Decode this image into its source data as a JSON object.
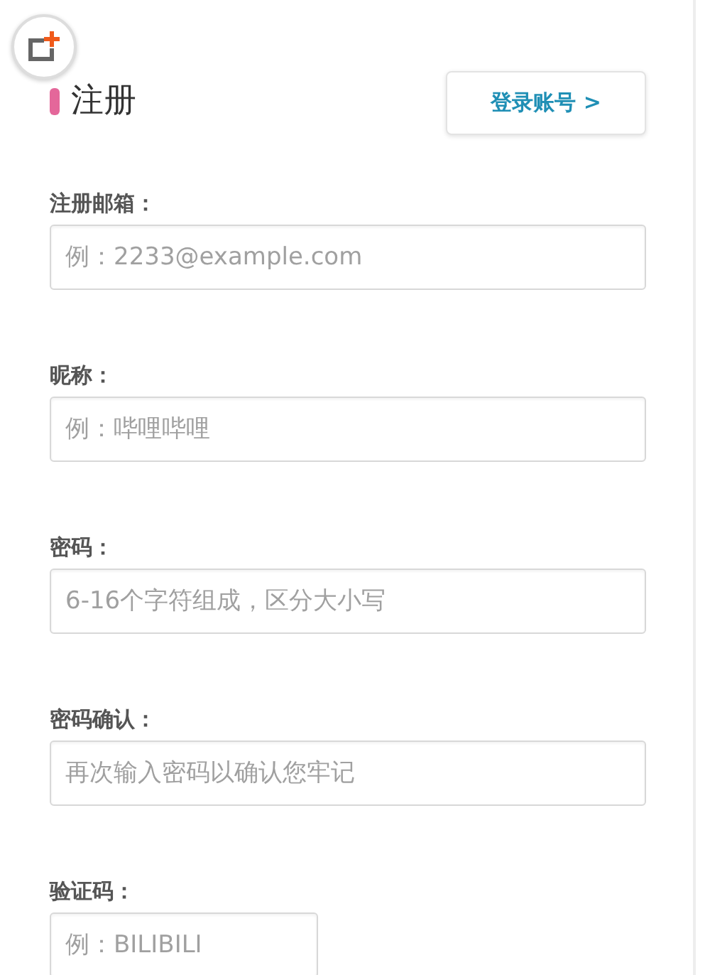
{
  "header": {
    "title": "注册",
    "login_button": "登录账号 >"
  },
  "fields": [
    {
      "label": "注册邮箱：",
      "placeholder": "例：2233@example.com",
      "kind": "full"
    },
    {
      "label": "昵称：",
      "placeholder": "例：哔哩哔哩",
      "kind": "full"
    },
    {
      "label": "密码：",
      "placeholder": "6-16个字符组成，区分大小写",
      "kind": "full"
    },
    {
      "label": "密码确认：",
      "placeholder": "再次输入密码以确认您牢记",
      "kind": "full"
    },
    {
      "label": "验证码：",
      "placeholder": "例：BILIBILI",
      "kind": "short"
    }
  ]
}
